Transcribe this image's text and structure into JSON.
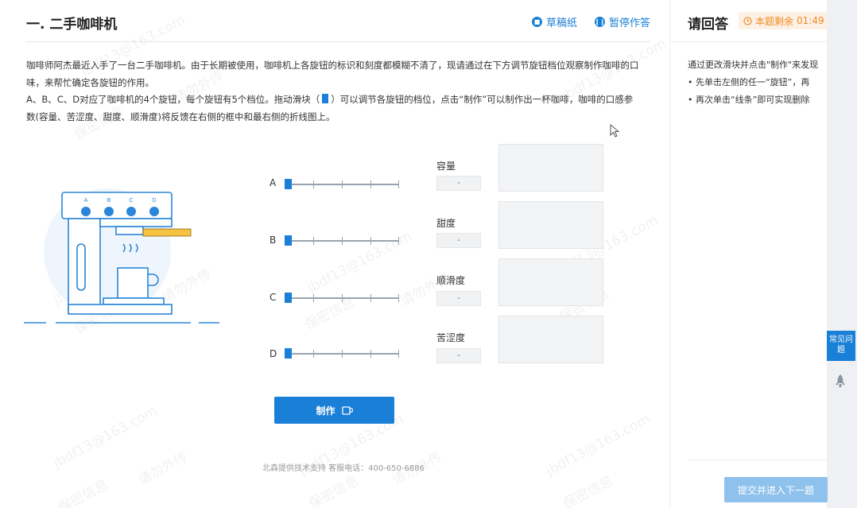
{
  "question": {
    "title": "一. 二手咖啡机",
    "draft_label": "草稿纸",
    "pause_label": "暂停作答",
    "desc_line1": "咖啡师阿杰最近入手了一台二手咖啡机。由于长期被使用，咖啡机上各旋钮的标识和刻度都模糊不清了，现请通过在下方调节旋钮档位观察制作咖啡的口",
    "desc_line2": "味，来帮忙确定各旋钮的作用。",
    "desc_line3a": "A、B、C、D对应了咖啡机的4个旋钮，每个旋钮有5个档位。拖动滑块（",
    "desc_line3b": "）可以调节各旋钮的档位，点击“制作”可以制作出一杯咖啡，咖啡的口感参",
    "desc_line4": "数(容量、苦涩度、甜度、顺滑度)将反馈在右侧的框中和最右侧的折线图上。"
  },
  "machine": {
    "knob_labels": [
      "A",
      "B",
      "C",
      "D"
    ]
  },
  "sliders": [
    {
      "label": "A",
      "position": 0,
      "positions_total": 5
    },
    {
      "label": "B",
      "position": 0,
      "positions_total": 5
    },
    {
      "label": "C",
      "position": 0,
      "positions_total": 5
    },
    {
      "label": "D",
      "position": 0,
      "positions_total": 5
    }
  ],
  "metrics": [
    {
      "label": "容量",
      "value": "-"
    },
    {
      "label": "甜度",
      "value": "-"
    },
    {
      "label": "顺滑度",
      "value": "-"
    },
    {
      "label": "苦涩度",
      "value": "-"
    }
  ],
  "make_button": {
    "label": "制作"
  },
  "footer": "北森提供技术支持 客服电话：400-650-6886",
  "watermark": {
    "texts": [
      "jbdf13@163.com",
      "保密信息",
      "请勿外传"
    ]
  },
  "answer_panel": {
    "title": "请回答",
    "timer_label": "本题剩余",
    "timer_value": "01:49",
    "intro": "通过更改滑块并点击\"制作\"来发现",
    "bullet1": "•  先单击左侧的任一“旋钮”，再",
    "bullet2": "•  再次单击“线条”即可实现删除",
    "submit_label": "提交并进入下一题"
  },
  "faq": {
    "label": "常见问题"
  },
  "colors": {
    "accent": "#1a7fd6",
    "timer": "#f08a24",
    "submit_disabled": "#8ec1ec"
  }
}
